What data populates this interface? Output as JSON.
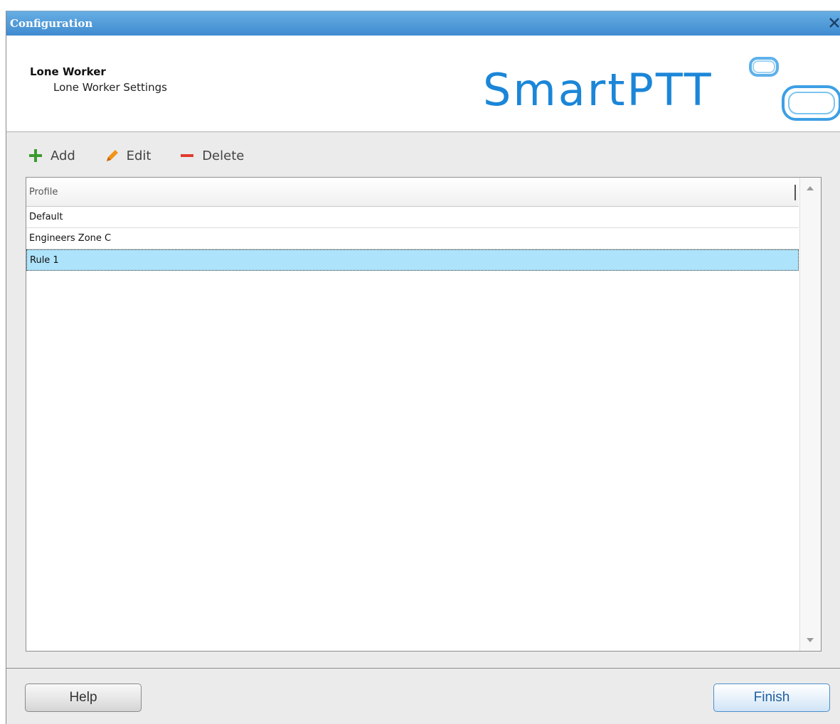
{
  "window": {
    "title": "Configuration"
  },
  "header": {
    "title": "Lone Worker",
    "subtitle": "Lone Worker Settings",
    "logo_text": "SmartPTT"
  },
  "toolbar": {
    "add_label": "Add",
    "edit_label": "Edit",
    "delete_label": "Delete"
  },
  "table": {
    "column_header": "Profile",
    "rows": [
      "Default",
      "Engineers Zone C",
      "Rule 1"
    ],
    "selected_index": 2
  },
  "footer": {
    "help_label": "Help",
    "finish_label": "Finish"
  },
  "colors": {
    "titlebar": "#4a97d8",
    "selected_row": "#aee4fb",
    "logo_blue": "#1b86d8",
    "add_icon": "#3a9a2e",
    "edit_icon": "#f29317",
    "delete_icon": "#e23b2f"
  }
}
